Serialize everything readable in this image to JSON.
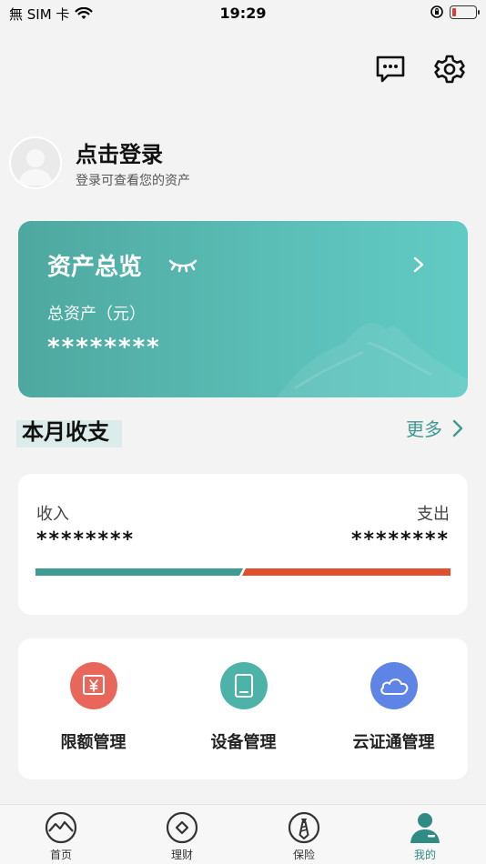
{
  "status_bar": {
    "carrier": "無 SIM 卡",
    "time": "19:29",
    "battery_level": 0.1,
    "battery_color": "#e53935"
  },
  "header": {
    "icons": [
      "message-icon",
      "gear-icon"
    ]
  },
  "profile": {
    "title": "点击登录",
    "subtitle": "登录可查看您的资产"
  },
  "asset_card": {
    "title": "资产总览",
    "label": "总资产（元）",
    "value": "********",
    "colors": {
      "start": "#4ea89f",
      "end": "#62cac4"
    }
  },
  "monthly": {
    "title": "本月收支",
    "more_label": "更多",
    "income_label": "收入",
    "income_value": "********",
    "expense_label": "支出",
    "expense_value": "********",
    "income_color": "#3f9a91",
    "expense_color": "#e1502c"
  },
  "services": [
    {
      "label": "限额管理",
      "icon": "yuan-limit-icon",
      "color": "#e9675a"
    },
    {
      "label": "设备管理",
      "icon": "device-icon",
      "color": "#4db2a8"
    },
    {
      "label": "云证通管理",
      "icon": "cloud-icon",
      "color": "#5e85e6"
    }
  ],
  "bottom_nav": {
    "items": [
      {
        "label": "首页",
        "icon": "home-mountain-icon",
        "active": false
      },
      {
        "label": "理财",
        "icon": "wealth-icon",
        "active": false
      },
      {
        "label": "保险",
        "icon": "insurance-icon",
        "active": false
      },
      {
        "label": "我的",
        "icon": "user-icon",
        "active": true
      }
    ],
    "active_color": "#2f8b83"
  }
}
